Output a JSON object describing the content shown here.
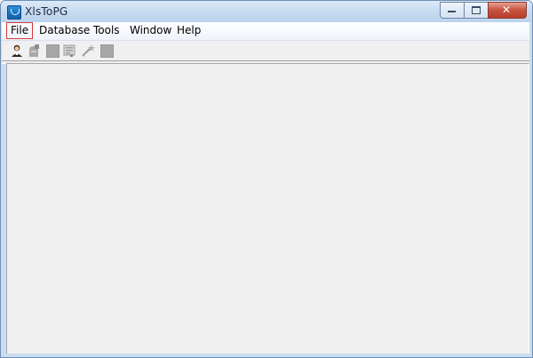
{
  "window": {
    "title": "XlsToPG",
    "caption_buttons": [
      "minimize",
      "maximize",
      "close"
    ]
  },
  "menu": {
    "items": [
      {
        "label": "File",
        "active": true
      },
      {
        "label": "Database",
        "active": false
      },
      {
        "label": "Tools",
        "active": false
      },
      {
        "label": "Window",
        "active": false
      },
      {
        "label": "Help",
        "active": false
      }
    ]
  },
  "toolbar": {
    "buttons": [
      {
        "icon": "connect-person-icon",
        "enabled": true
      },
      {
        "icon": "disconnect-icon",
        "enabled": false
      },
      {
        "icon": "stop-icon",
        "enabled": false
      },
      {
        "icon": "form-icon",
        "enabled": false
      },
      {
        "icon": "wand-icon",
        "enabled": false
      },
      {
        "icon": "stop-icon",
        "enabled": false
      }
    ]
  },
  "colors": {
    "active_menu_border": "#d63a3a",
    "client_background": "#f0f0f0"
  }
}
